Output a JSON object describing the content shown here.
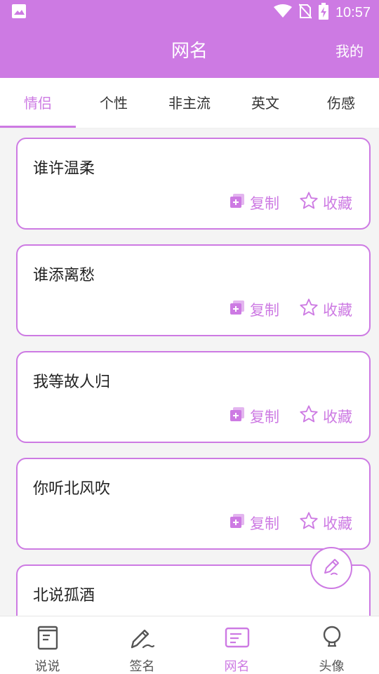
{
  "status_bar": {
    "time": "10:57",
    "icons": [
      "image-icon",
      "wifi-icon",
      "no-signal-icon",
      "battery-charging-icon"
    ]
  },
  "app_bar": {
    "title": "网名",
    "action": "我的"
  },
  "tabs": [
    {
      "label": "情侣",
      "active": true
    },
    {
      "label": "个性",
      "active": false
    },
    {
      "label": "非主流",
      "active": false
    },
    {
      "label": "英文",
      "active": false
    },
    {
      "label": "伤感",
      "active": false
    }
  ],
  "items": [
    {
      "name": "谁许温柔"
    },
    {
      "name": "谁添离愁"
    },
    {
      "name": "我等故人归"
    },
    {
      "name": "你听北风吹"
    },
    {
      "name": "北说孤酒"
    }
  ],
  "actions": {
    "copy": "复制",
    "favorite": "收藏"
  },
  "bottom_nav": [
    {
      "label": "说说",
      "icon": "notebook-icon",
      "active": false
    },
    {
      "label": "签名",
      "icon": "signature-pen-icon",
      "active": false
    },
    {
      "label": "网名",
      "icon": "name-card-icon",
      "active": true
    },
    {
      "label": "头像",
      "icon": "avatar-icon",
      "active": false
    }
  ],
  "colors": {
    "accent": "#cd7ae3",
    "background": "#f4f4f4"
  }
}
